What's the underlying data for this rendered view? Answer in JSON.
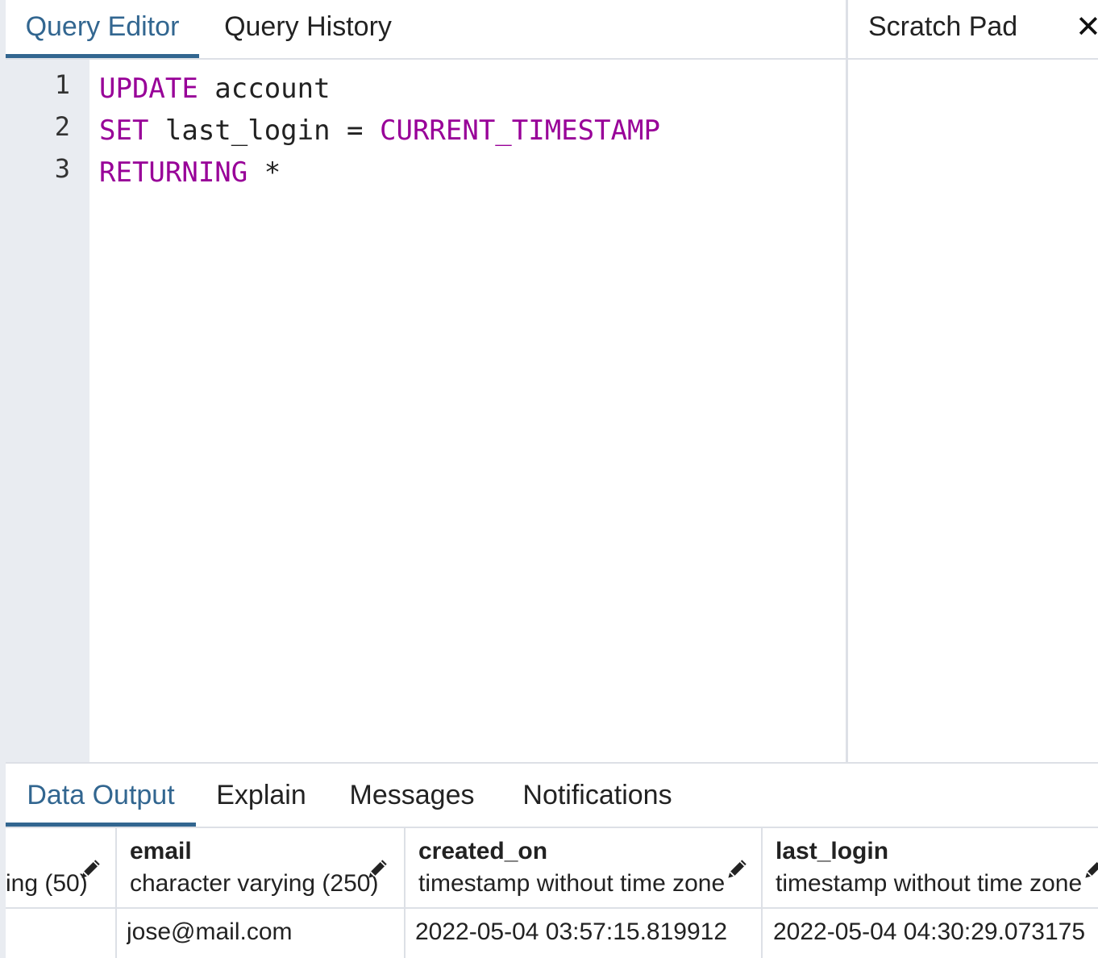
{
  "query_tabs": [
    {
      "label": "Query Editor",
      "active": true
    },
    {
      "label": "Query History",
      "active": false
    }
  ],
  "scratch_pad": {
    "title": "Scratch Pad",
    "close_icon": "close-icon"
  },
  "editor": {
    "lines": [
      {
        "number": "1",
        "tokens": [
          {
            "text": "UPDATE",
            "type": "keyword"
          },
          {
            "text": " account",
            "type": "identifier"
          }
        ]
      },
      {
        "number": "2",
        "tokens": [
          {
            "text": "SET",
            "type": "keyword"
          },
          {
            "text": " last_login = ",
            "type": "identifier"
          },
          {
            "text": "CURRENT_TIMESTAMP",
            "type": "keyword"
          }
        ]
      },
      {
        "number": "3",
        "tokens": [
          {
            "text": "RETURNING",
            "type": "keyword"
          },
          {
            "text": " *",
            "type": "identifier"
          }
        ]
      }
    ],
    "keyword_color": "#980098"
  },
  "output_tabs": [
    {
      "label": "Data Output",
      "active": true
    },
    {
      "label": "Explain",
      "active": false
    },
    {
      "label": "Messages",
      "active": false
    },
    {
      "label": "Notifications",
      "active": false
    }
  ],
  "grid": {
    "columns": [
      {
        "name": "",
        "type": "ing (50)",
        "editable_icon": "pencil-icon"
      },
      {
        "name": "email",
        "type": "character varying (250)",
        "editable_icon": "pencil-icon"
      },
      {
        "name": "created_on",
        "type": "timestamp without time zone",
        "editable_icon": "pencil-icon"
      },
      {
        "name": "last_login",
        "type": "timestamp without time zone",
        "editable_icon": "pencil-icon"
      }
    ],
    "rows": [
      [
        "",
        "jose@mail.com",
        "2022-05-04 03:57:15.819912",
        "2022-05-04 04:30:29.073175"
      ]
    ]
  },
  "accent_color": "#326690"
}
